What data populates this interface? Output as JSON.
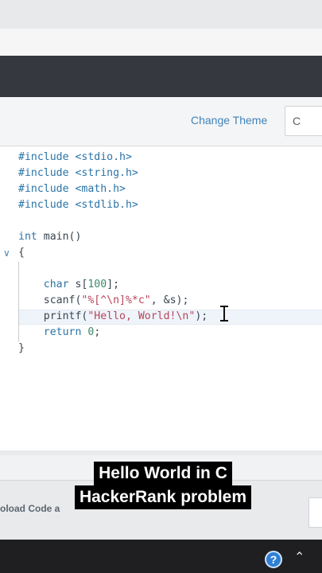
{
  "toolbar": {
    "change_theme": "Change Theme",
    "language": "C"
  },
  "editor": {
    "lines": [
      [
        {
          "t": "#include <stdio.h>",
          "c": "kw"
        }
      ],
      [
        {
          "t": "#include <string.h>",
          "c": "kw"
        }
      ],
      [
        {
          "t": "#include <math.h>",
          "c": "kw"
        }
      ],
      [
        {
          "t": "#include <stdlib.h>",
          "c": "kw"
        }
      ],
      [],
      [
        {
          "t": "int",
          "c": "kw"
        },
        {
          "t": " main()"
        }
      ],
      [
        {
          "t": "{"
        }
      ],
      [],
      [
        {
          "t": "    "
        },
        {
          "t": "char",
          "c": "kw"
        },
        {
          "t": " s["
        },
        {
          "t": "100",
          "c": "num"
        },
        {
          "t": "];"
        }
      ],
      [
        {
          "t": "    scanf("
        },
        {
          "t": "\"%[^\\n]%*c\"",
          "c": "str"
        },
        {
          "t": ", &s);"
        }
      ],
      [
        {
          "t": "    printf("
        },
        {
          "t": "\"Hello, World!\\n\"",
          "c": "str"
        },
        {
          "t": ");"
        }
      ],
      [
        {
          "t": "    "
        },
        {
          "t": "return",
          "c": "kw"
        },
        {
          "t": " "
        },
        {
          "t": "0",
          "c": "num"
        },
        {
          "t": ";"
        }
      ],
      [
        {
          "t": "}"
        }
      ]
    ]
  },
  "bottom": {
    "upload_label": "oload Code a"
  },
  "caption": {
    "line1": "Hello World in C",
    "line2": "HackerRank problem"
  },
  "colors": {
    "keyword": "#2b73a6",
    "string": "#b8455b",
    "number": "#3b8a6a",
    "link": "#3f82b9"
  },
  "icons": {
    "fold": "chevron-down-icon",
    "help": "help-icon",
    "tray": "chevron-up-icon",
    "cursor": "text-cursor-icon"
  }
}
